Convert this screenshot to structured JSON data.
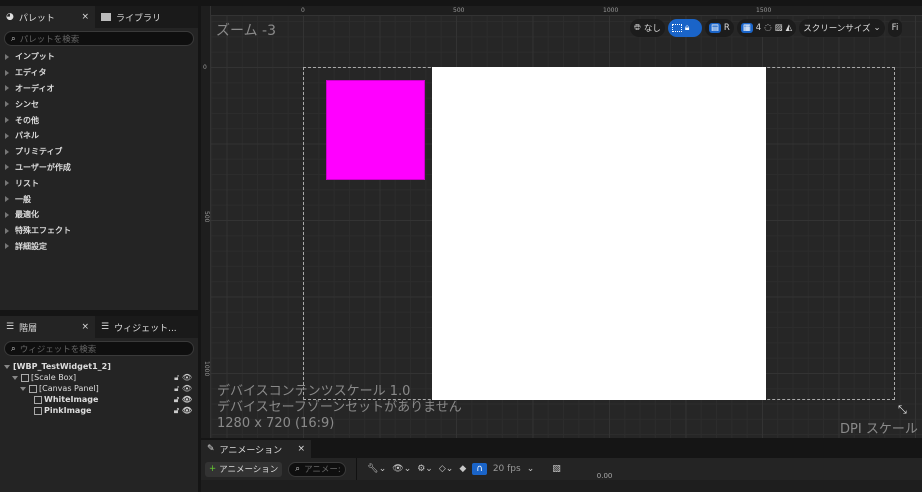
{
  "palette": {
    "tab_label": "パレット",
    "library_tab": "ライブラリ",
    "search_placeholder": "パレットを検索",
    "categories": [
      "インプット",
      "エディタ",
      "オーディオ",
      "シンセ",
      "その他",
      "パネル",
      "プリミティブ",
      "ユーザーが作成",
      "リスト",
      "一般",
      "最適化",
      "特殊エフェクト",
      "詳細設定"
    ]
  },
  "hierarchy": {
    "tab_label": "階層",
    "widgets_tab": "ウィジェット...",
    "search_placeholder": "ウィジェットを検索",
    "items": [
      {
        "label": "[WBP_TestWidget1_2]"
      },
      {
        "label": "[Scale Box]"
      },
      {
        "label": "[Canvas Panel]"
      },
      {
        "label": "WhiteImage"
      },
      {
        "label": "PinkImage"
      }
    ]
  },
  "viewport": {
    "zoom": "ズーム -3",
    "ruler_h": [
      "0",
      "500",
      "1000",
      "1500"
    ],
    "ruler_v": [
      "0",
      "500",
      "1000"
    ],
    "toolbar": {
      "none": "なし",
      "r": "R",
      "grid": "4",
      "screen_size": "スクリーンサイズ",
      "fill": "Fi"
    },
    "overlay": [
      "デバイスコンテンツスケール 1.0",
      "デバイスセーフゾーンセットがありません",
      "1280 x 720 (16:9)"
    ],
    "dpi": "DPI スケール",
    "pink_color": "#ff00ff"
  },
  "animation": {
    "tab_label": "アニメーション",
    "add_button": "アニメーション",
    "search_placeholder": "アニメー:",
    "fps": "20 fps",
    "time": "0.00"
  }
}
